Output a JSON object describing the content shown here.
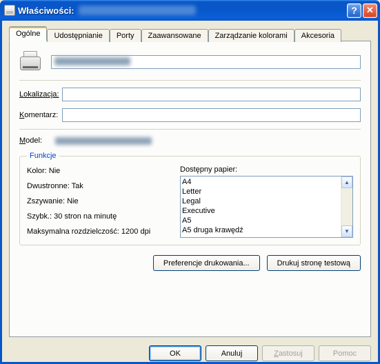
{
  "titlebar": {
    "title": "Właściwości:"
  },
  "tabs": {
    "general": "Ogólne",
    "sharing": "Udostępnianie",
    "ports": "Porty",
    "advanced": "Zaawansowane",
    "color": "Zarządzanie kolorami",
    "accessories": "Akcesoria"
  },
  "general": {
    "location_label": "Lokalizacja:",
    "comment_label": "Komentarz:",
    "model_label": "Model:"
  },
  "funkcje": {
    "legend": "Funkcje",
    "color": "Kolor: Nie",
    "duplex": "Dwustronne: Tak",
    "staple": "Zszywanie: Nie",
    "speed": "Szybk.: 30 stron na minutę",
    "resolution": "Maksymalna rozdzielczość: 1200  dpi",
    "paper_label": "Dostępny papier:",
    "paper": [
      "A4",
      "Letter",
      "Legal",
      "Executive",
      "A5",
      "A5 druga krawędź"
    ]
  },
  "buttons": {
    "prefs": "Preferencje drukowania...",
    "test": "Drukuj stronę testową",
    "ok": "OK",
    "cancel": "Anuluj",
    "apply": "Zastosuj",
    "help": "Pomoc"
  }
}
